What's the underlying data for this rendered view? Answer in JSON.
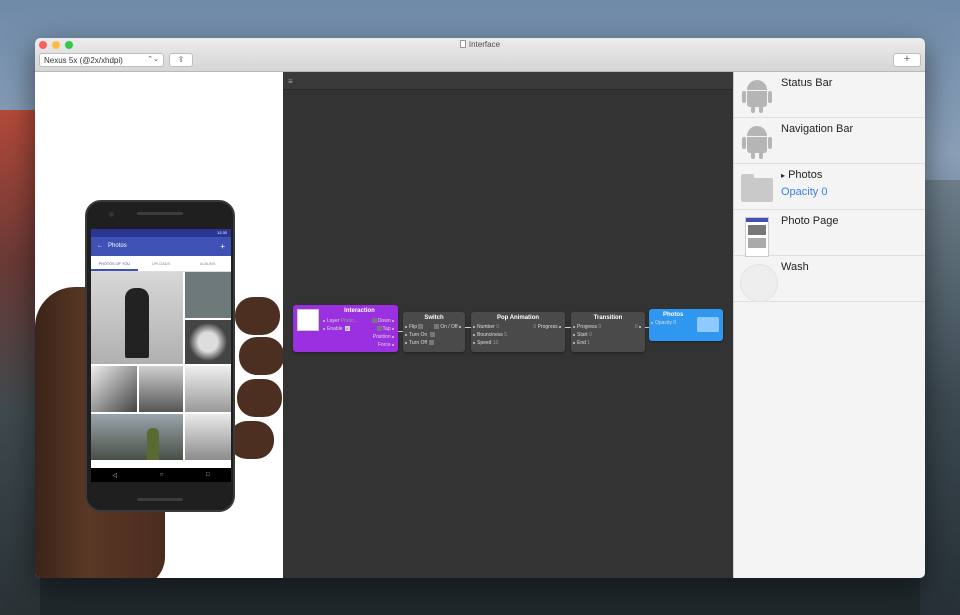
{
  "window": {
    "title": "Interface"
  },
  "toolbar": {
    "device": "Nexus 5x (@2x/xhdpi)",
    "device_arrows": "⌃⌄",
    "share_icon": "⇪",
    "add_icon": "+"
  },
  "phone_app": {
    "status_time": "12:30",
    "title": "Photos",
    "back_icon": "←",
    "add_icon": "+",
    "tabs": [
      "PHOTOS OF YOU",
      "UPLOADS",
      "ALBUMS"
    ],
    "nav": [
      "◁",
      "○",
      "□"
    ]
  },
  "editor": {
    "menu_icon": "≡"
  },
  "patches": {
    "interaction": {
      "title": "Interaction",
      "inputs": [
        {
          "label": "Layer",
          "value": "Photo..."
        },
        {
          "label": "Enable",
          "value": ""
        }
      ],
      "outputs": [
        "Down",
        "Tap",
        "Position",
        "Force"
      ],
      "check_mark": "✓"
    },
    "switch": {
      "title": "Switch",
      "inputs": [
        {
          "label": "Flip"
        },
        {
          "label": "Turn On"
        },
        {
          "label": "Turn Off"
        }
      ],
      "outputs": [
        "On / Off"
      ]
    },
    "pop_animation": {
      "title": "Pop Animation",
      "inputs": [
        {
          "label": "Number",
          "value": "0"
        },
        {
          "label": "Bounciness",
          "value": "5"
        },
        {
          "label": "Speed",
          "value": "10"
        }
      ],
      "outputs": [
        "Progress"
      ],
      "output_value": "0"
    },
    "transition": {
      "title": "Transition",
      "inputs": [
        {
          "label": "Progress",
          "value": "0"
        },
        {
          "label": "Start",
          "value": "0"
        },
        {
          "label": "End",
          "value": "1"
        }
      ],
      "output_value": "0"
    },
    "photos": {
      "title": "Photos",
      "inputs": [
        {
          "label": "Opacity",
          "value": "0"
        }
      ]
    }
  },
  "layers": [
    {
      "name": "Status Bar",
      "icon": "android-icon"
    },
    {
      "name": "Navigation Bar",
      "icon": "android-icon"
    },
    {
      "name": "Photos",
      "disclosure": "▸",
      "sub": "Opacity 0",
      "icon": "folder-icon"
    },
    {
      "name": "Photo Page",
      "icon": "page-thumbnail"
    },
    {
      "name": "Wash",
      "icon": "wash-circle"
    }
  ]
}
